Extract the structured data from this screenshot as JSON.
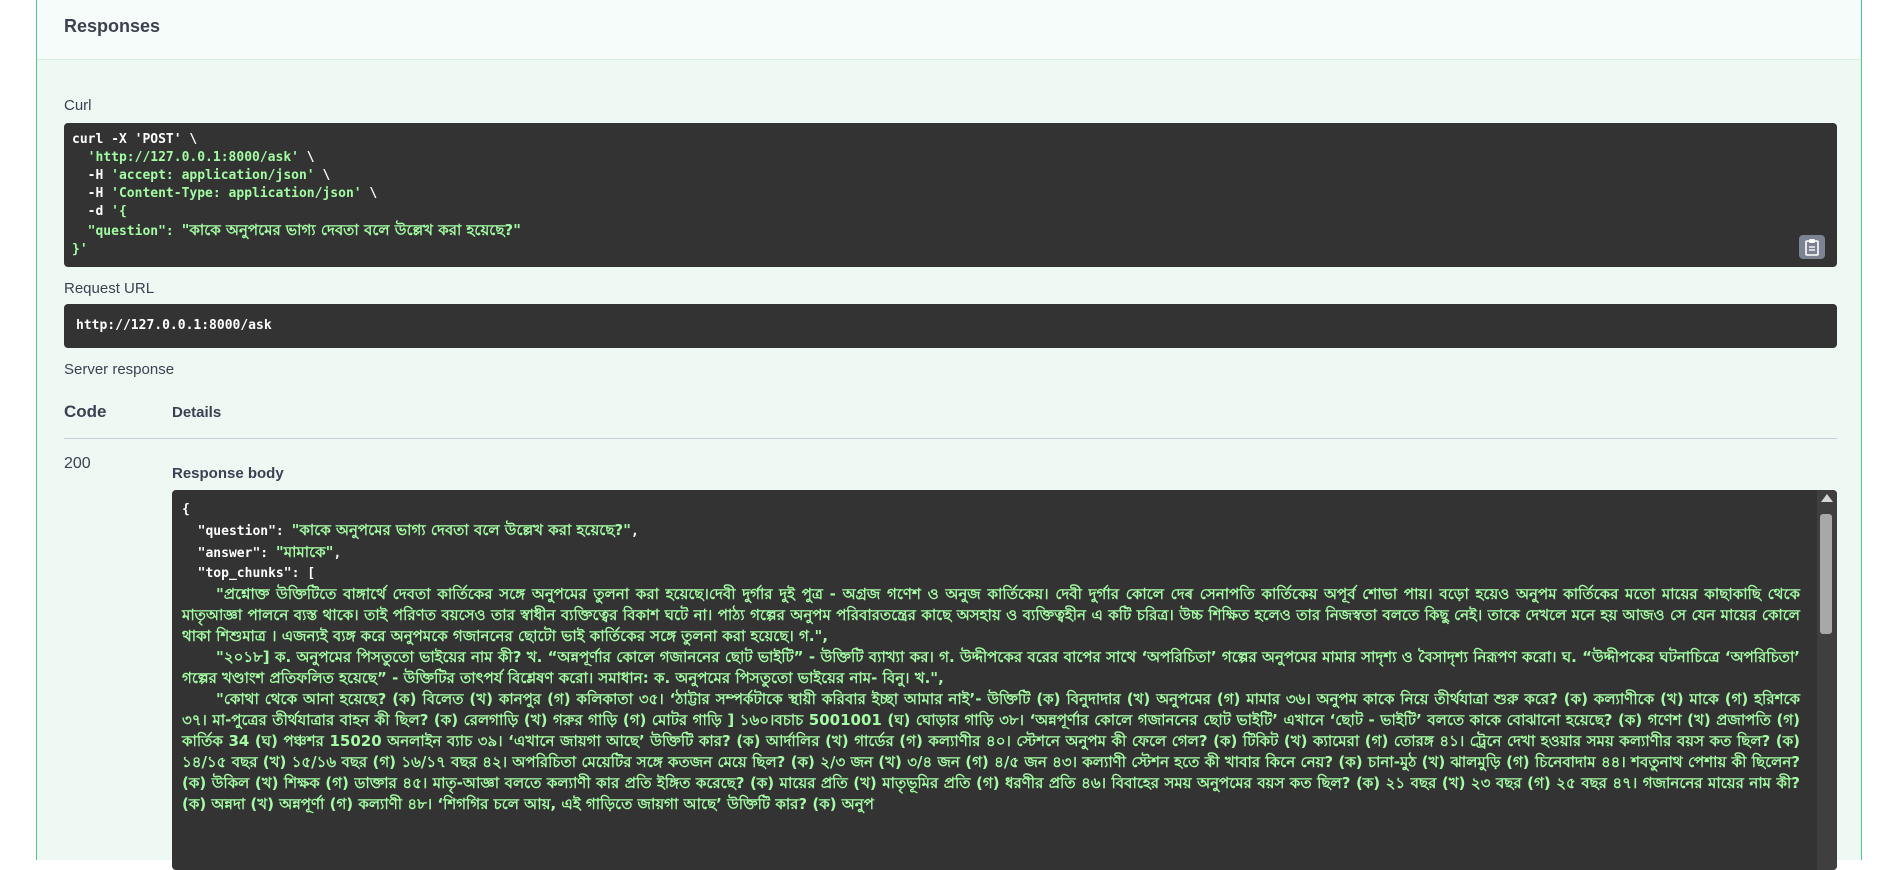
{
  "responses": {
    "title": "Responses"
  },
  "curl": {
    "label": "Curl",
    "line1": "curl -X 'POST' \\",
    "line2_a": "  ",
    "line2_url": "'http://127.0.0.1:8000/ask'",
    "line2_b": " \\",
    "line3_a": "  -H ",
    "line3_str": "'accept: application/json'",
    "line3_b": " \\",
    "line4_a": "  -H ",
    "line4_str": "'Content-Type: application/json'",
    "line4_b": " \\",
    "line5_a": "  -d ",
    "line5_str": "'{",
    "line6_key": "  \"question\": ",
    "line6_val": "\"কাকে অনুপমের ভাগ্য দেবতা বলে উল্লেখ করা হয়েছে?\"",
    "line7": "}'",
    "copy_icon": "clipboard-icon"
  },
  "request_url": {
    "label": "Request URL",
    "value": "http://127.0.0.1:8000/ask"
  },
  "server_response": {
    "label": "Server response",
    "code_header": "Code",
    "details_header": "Details",
    "code": "200",
    "body_label": "Response body"
  },
  "response_body": {
    "open_brace": "{",
    "question_key": "  \"question\": ",
    "question_val": "\"কাকে অনুপমের ভাগ্য দেবতা বলে উল্লেখ করা হয়েছে?\"",
    "question_comma": ",",
    "answer_key": "  \"answer\": ",
    "answer_val": "\"মামাকে\"",
    "answer_comma": ",",
    "top_chunks_key": "  \"top_chunks\": ",
    "top_chunks_open": "[",
    "chunks": [
      "\"প্রশ্নোক্ত উক্তিটিতে বাঙ্গার্থে দেবতা কার্তিকের সঙ্গে অনুপমের তুলনা করা হয়েছে।দেবী দুর্গার দুই পুত্র - অগ্রজ গণেশ ও অনুজ কার্তিকেয়। দেবী দুর্গার কোলে দেৰ সেনাপতি কার্তিকেয় অপূর্ব শোভা পায়। বড়ো হয়েও অনুপম কার্তিকের মতো মায়ের কাছাকাছি থেকে মাতৃআজ্ঞা পালনে ব্যস্ত থাকে। তাই পরিণত বয়সেও তার স্বাধীন ব্যক্তিত্বের বিকাশ ঘটে না। পাঠ্য গল্পের অনুপম পরিবারতন্ত্রের কাছে অসহায় ও ব্যক্তিত্বহীন এ কটি চরিত্র। উচ্চ শিক্ষিত হলেও তার নিজস্বতা বলতে কিছু নেই। তাকে দেখলে মনে হয় আজও সে যেন মায়ের কোলে থাকা শিশুমাত্র । এজন্যই ব্যঙ্গ করে অনুপমকে গজাননের ছোটো ভাই কার্তিকের সঙ্গে তুলনা করা হয়েছে। গ.\",",
      "\"২০১৮] ক. অনুপমের পিসতুতো ভাইয়ের নাম কী? খ. “অন্নপূর্ণার কোলে গজাননের ছোট ভাইটি” - উক্তিটি ব্যাখ্যা কর। গ. উদ্দীপকের বরের বাপের সাথে ‘অপরিচিতা’ গল্পের অনুপমের মামার সাদৃশ্য ও বৈসাদৃশ্য নিরূপণ করো। ঘ. “উদ্দীপকের ঘটনাচিত্রে ‘অপরিচিতা’ গল্পের খণ্ডাংশ প্রতিফলিত হয়েছে” - উক্তিটির তাৎপর্য বিশ্লেষণ করো। সমাধান: ক. অনুপমের পিসতুতো ভাইয়ের নাম- বিনু। খ.\",",
      "\"কোথা থেকে আনা হয়েছে? (ক) বিলেত (খ) কানপুর (গ) কলিকাতা ৩৫। ‘ঠাট্টার সম্পর্কটাকে স্থায়ী করিবার ইচ্ছা আমার নাই’- উক্তিটি (ক) বিনুদাদার (খ) অনুপমের (গ) মামার ৩৬। অনুপম কাকে নিয়ে তীর্থযাত্রা শুরু করে? (ক) কল্যাণীকে (খ) মাকে (গ) হরিশকে ৩৭। মা-পুত্রের তীর্থযাত্রার বাহন কী ছিল? (ক) রেলগাড়ি (খ) গরুর গাড়ি (গ) মোটর গাড়ি ] ১৬০।বচাচ 5001001 (ঘ) ঘোড়ার গাড়ি ৩৮। ‘অন্নপূর্ণার কোলে গজাননের ছোট ভাইটি’ এখানে ‘ছোট - ভাইটি’ বলতে কাকে বোঝানো হয়েছে? (ক) গণেশ (খ) প্রজাপতি (গ) কার্তিক 34 (ঘ) পঞ্চশর 15020 অনলাইন ব্যাচ ৩৯। ‘এখানে জায়গা আছে’ উক্তিটি কার? (ক) আর্দালির (খ) গার্ডের (গ) কল্যাণীর ৪০। স্টেশনে অনুপম কী ফেলে গেল? (ক) টিকিট (খ) ক্যামেরা (গ) তোরঙ্গ ৪১। ট্রেনে দেখা হওয়ার সময় কল্যাণীর বয়স কত ছিল? (ক) ১৪/১৫ বছর (খ) ১৫/১৬ বছর (গ) ১৬/১৭ বছর ৪২। অপরিচিতা মেয়েটির সঙ্গে কতজন মেয়ে ছিল? (ক) ২/৩ জন (খ) ৩/৪ জন (গ) ৪/৫ জন ৪৩। কল্যাণী স্টেশন হতে কী খাবার কিনে নেয়? (ক) চানা-মুঠ (খ) ঝালমুড়ি (গ) চিনেবাদাম ৪৪। শবতুনাথ পেশায় কী ছিলেন? (ক) উকিল (খ) শিক্ষক (গ) ডাক্তার ৪৫। মাতৃ-আজ্ঞা বলতে কল্যাণী কার প্রতি ইঙ্গিত করেছে? (ক) মায়ের প্রতি (খ) মাতৃভূমির প্রতি (গ) ধরণীর প্রতি ৪৬। বিবাহের সময় অনুপমের বয়স কত ছিল? (ক) ২১ বছর (খ) ২৩ বছর (গ) ২৫ বছর ৪৭। গজাননের মায়ের নাম কী? (ক) অন্নদা (খ) অন্নপূর্ণা (গ) কল্যাণী ৪৮। ‘শিগগির চলে আয়, এই গাড়িতে জায়গা আছে’ উক্তিটি কার? (ক) অনুপ"
    ]
  }
}
